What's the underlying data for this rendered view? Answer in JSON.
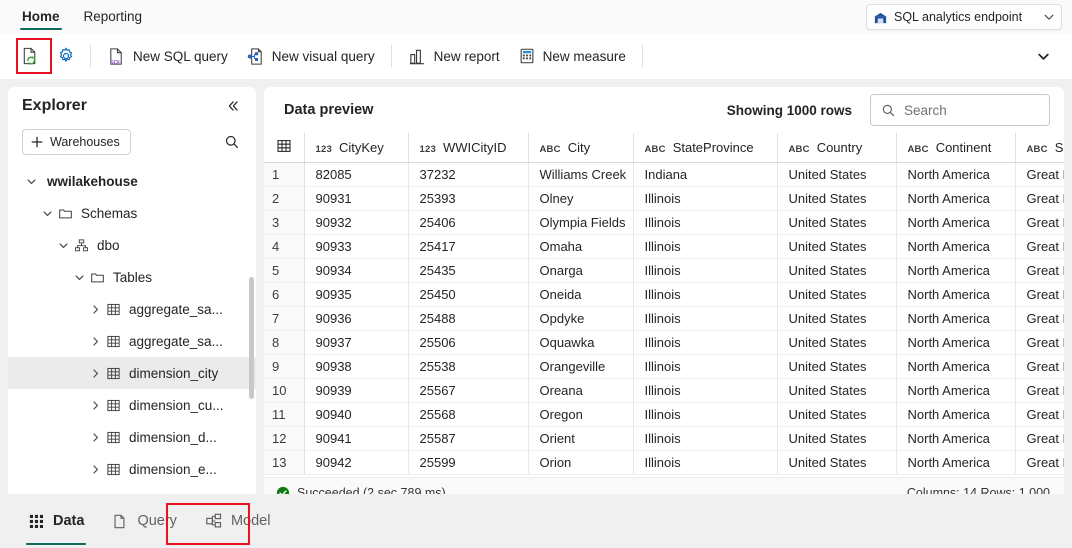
{
  "ribbon": {
    "tabs": [
      {
        "label": "Home",
        "active": true
      },
      {
        "label": "Reporting",
        "active": false
      }
    ],
    "endpoint": {
      "label": "SQL analytics endpoint",
      "icon": "warehouse-icon",
      "caret": "⌄"
    }
  },
  "toolbar": {
    "refresh_icon": "refresh-document-icon",
    "settings_icon": "gear-icon",
    "buttons": [
      {
        "label": "New SQL query",
        "icon": "sql-file-icon"
      },
      {
        "label": "New visual query",
        "icon": "visual-query-icon"
      },
      {
        "label": "New report",
        "icon": "report-chart-icon"
      },
      {
        "label": "New measure",
        "icon": "calculator-icon"
      }
    ],
    "overflow_caret": "⌄"
  },
  "explorer": {
    "title": "Explorer",
    "collapse_icon": "collapse-chevrons-icon",
    "warehouses_button": "Warehouses",
    "add_icon": "plus-icon",
    "search_icon": "search-icon",
    "tree": [
      {
        "label": "wwilakehouse",
        "depth": 0,
        "chevron": "⌄",
        "icon": "none",
        "bold": true,
        "selected": false
      },
      {
        "label": "Schemas",
        "depth": 1,
        "chevron": "⌄",
        "icon": "folder-icon",
        "bold": false,
        "selected": false
      },
      {
        "label": "dbo",
        "depth": 2,
        "chevron": "⌄",
        "icon": "schema-icon",
        "bold": false,
        "selected": false
      },
      {
        "label": "Tables",
        "depth": 3,
        "chevron": "⌄",
        "icon": "folder-icon",
        "bold": false,
        "selected": false
      },
      {
        "label": "aggregate_sa...",
        "depth": 4,
        "chevron": "›",
        "icon": "table-icon",
        "bold": false,
        "selected": false
      },
      {
        "label": "aggregate_sa...",
        "depth": 4,
        "chevron": "›",
        "icon": "table-icon",
        "bold": false,
        "selected": false
      },
      {
        "label": "dimension_city",
        "depth": 4,
        "chevron": "›",
        "icon": "table-icon",
        "bold": false,
        "selected": true
      },
      {
        "label": "dimension_cu...",
        "depth": 4,
        "chevron": "›",
        "icon": "table-icon",
        "bold": false,
        "selected": false
      },
      {
        "label": "dimension_d...",
        "depth": 4,
        "chevron": "›",
        "icon": "table-icon",
        "bold": false,
        "selected": false
      },
      {
        "label": "dimension_e...",
        "depth": 4,
        "chevron": "›",
        "icon": "table-icon",
        "bold": false,
        "selected": false
      }
    ]
  },
  "preview": {
    "title": "Data preview",
    "rows_showing": "Showing 1000 rows",
    "search_placeholder": "Search",
    "search_value": "",
    "search_icon": "search-icon",
    "grid_corner_icon": "grid-corner-icon",
    "columns": [
      {
        "name": "CityKey",
        "type": "123",
        "cls": "col-key"
      },
      {
        "name": "WWICityID",
        "type": "123",
        "cls": "col-wwi"
      },
      {
        "name": "City",
        "type": "ABC",
        "cls": "col-city"
      },
      {
        "name": "StateProvince",
        "type": "ABC",
        "cls": "col-state"
      },
      {
        "name": "Country",
        "type": "ABC",
        "cls": "col-cty"
      },
      {
        "name": "Continent",
        "type": "ABC",
        "cls": "col-cont"
      },
      {
        "name": "Sale",
        "type": "ABC",
        "cls": "col-sale"
      }
    ],
    "rows": [
      {
        "n": "1",
        "cells": [
          "82085",
          "37232",
          "Williams Creek",
          "Indiana",
          "United States",
          "North America",
          "Great La"
        ]
      },
      {
        "n": "2",
        "cells": [
          "90931",
          "25393",
          "Olney",
          "Illinois",
          "United States",
          "North America",
          "Great La"
        ]
      },
      {
        "n": "3",
        "cells": [
          "90932",
          "25406",
          "Olympia Fields",
          "Illinois",
          "United States",
          "North America",
          "Great La"
        ]
      },
      {
        "n": "4",
        "cells": [
          "90933",
          "25417",
          "Omaha",
          "Illinois",
          "United States",
          "North America",
          "Great La"
        ]
      },
      {
        "n": "5",
        "cells": [
          "90934",
          "25435",
          "Onarga",
          "Illinois",
          "United States",
          "North America",
          "Great La"
        ]
      },
      {
        "n": "6",
        "cells": [
          "90935",
          "25450",
          "Oneida",
          "Illinois",
          "United States",
          "North America",
          "Great La"
        ]
      },
      {
        "n": "7",
        "cells": [
          "90936",
          "25488",
          "Opdyke",
          "Illinois",
          "United States",
          "North America",
          "Great La"
        ]
      },
      {
        "n": "8",
        "cells": [
          "90937",
          "25506",
          "Oquawka",
          "Illinois",
          "United States",
          "North America",
          "Great La"
        ]
      },
      {
        "n": "9",
        "cells": [
          "90938",
          "25538",
          "Orangeville",
          "Illinois",
          "United States",
          "North America",
          "Great La"
        ]
      },
      {
        "n": "10",
        "cells": [
          "90939",
          "25567",
          "Oreana",
          "Illinois",
          "United States",
          "North America",
          "Great La"
        ]
      },
      {
        "n": "11",
        "cells": [
          "90940",
          "25568",
          "Oregon",
          "Illinois",
          "United States",
          "North America",
          "Great La"
        ]
      },
      {
        "n": "12",
        "cells": [
          "90941",
          "25587",
          "Orient",
          "Illinois",
          "United States",
          "North America",
          "Great La"
        ]
      },
      {
        "n": "13",
        "cells": [
          "90942",
          "25599",
          "Orion",
          "Illinois",
          "United States",
          "North America",
          "Great La"
        ]
      }
    ],
    "status": {
      "icon": "success-check-icon",
      "text": "Succeeded (2 sec 789 ms)",
      "summary": "Columns: 14  Rows: 1,000"
    }
  },
  "viewbar": {
    "items": [
      {
        "label": "Data",
        "icon": "data-grid-icon",
        "active": true,
        "highlighted": false
      },
      {
        "label": "Query",
        "icon": "query-page-icon",
        "active": false,
        "highlighted": false
      },
      {
        "label": "Model",
        "icon": "model-nodes-icon",
        "active": false,
        "highlighted": true
      }
    ]
  },
  "colors": {
    "accent_teal": "#0f6b5c",
    "annotation_red": "#e81123",
    "success_green": "#107c10",
    "brand_blue": "#0f6cbd",
    "refresh_green": "#3aa33a"
  }
}
